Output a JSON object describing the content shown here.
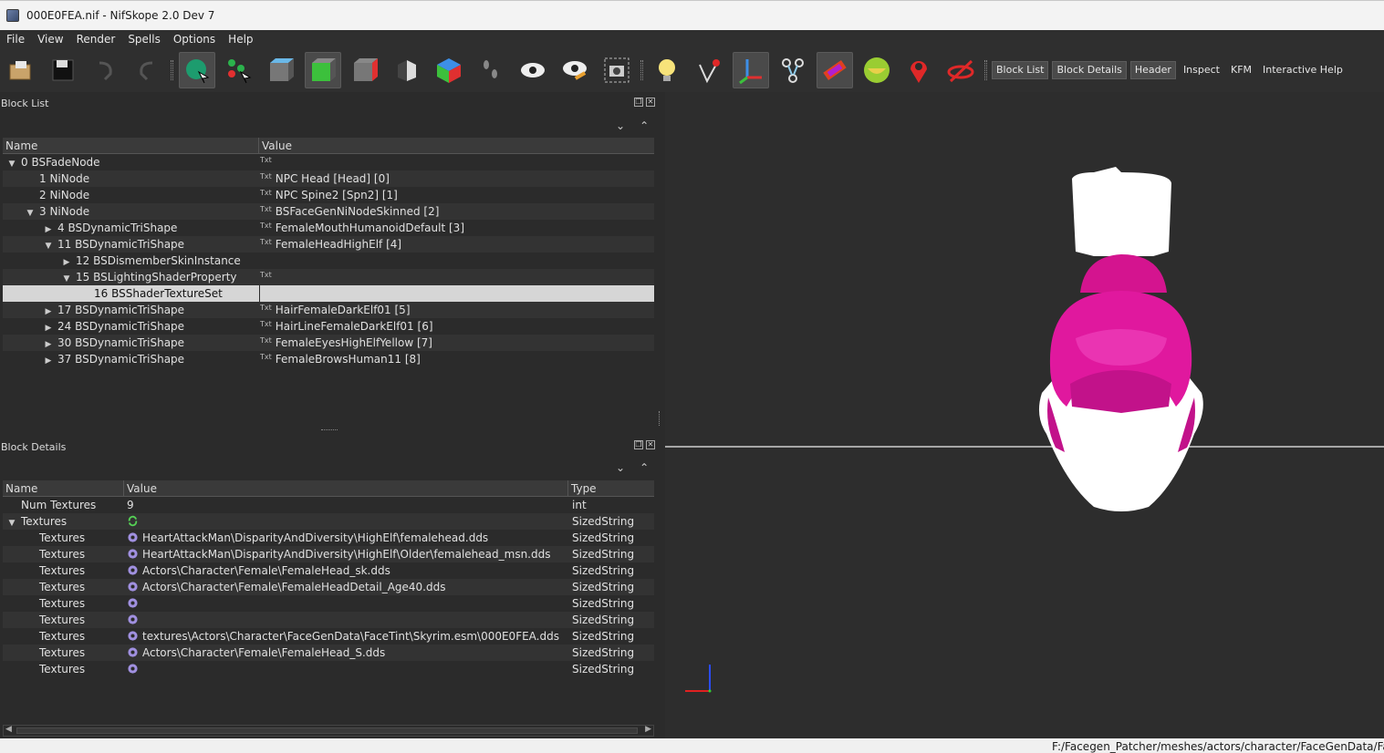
{
  "window": {
    "title": "000E0FEA.nif - NifSkope 2.0 Dev 7"
  },
  "menu": [
    "File",
    "View",
    "Render",
    "Spells",
    "Options",
    "Help"
  ],
  "toolbar": {
    "icons": [
      "load-icon",
      "save-icon",
      "undo-icon",
      "redo-icon",
      "select-icon",
      "select-nodes-icon",
      "view-top-icon",
      "view-front-icon",
      "view-side-icon",
      "view-user-icon",
      "view-axes-icon",
      "walk-icon",
      "show-hidden-icon",
      "show-markers-icon",
      "screenshot-icon",
      "lighting-icon",
      "vertex-icon",
      "axes-icon",
      "nodes-icon",
      "textures-icon",
      "skeleton-icon",
      "marker-icon",
      "constraint-icon"
    ],
    "tabs": [
      "Block List",
      "Block Details",
      "Header",
      "Inspect",
      "KFM",
      "Interactive Help"
    ]
  },
  "block_list": {
    "title": "Block List",
    "columns": [
      "Name",
      "Value"
    ],
    "rows": [
      {
        "name": "0 BSFadeNode",
        "value": "",
        "txt": true,
        "indent": 0,
        "arrow": "down"
      },
      {
        "name": "1 NiNode",
        "value": "NPC Head [Head] [0]",
        "txt": true,
        "indent": 1,
        "arrow": ""
      },
      {
        "name": "2 NiNode",
        "value": "NPC Spine2 [Spn2] [1]",
        "txt": true,
        "indent": 1,
        "arrow": ""
      },
      {
        "name": "3 NiNode",
        "value": "BSFaceGenNiNodeSkinned [2]",
        "txt": true,
        "indent": 1,
        "arrow": "down"
      },
      {
        "name": "4 BSDynamicTriShape",
        "value": "FemaleMouthHumanoidDefault [3]",
        "txt": true,
        "indent": 2,
        "arrow": "right"
      },
      {
        "name": "11 BSDynamicTriShape",
        "value": "FemaleHeadHighElf [4]",
        "txt": true,
        "indent": 2,
        "arrow": "down"
      },
      {
        "name": "12 BSDismemberSkinInstance",
        "value": "",
        "txt": false,
        "indent": 3,
        "arrow": "right"
      },
      {
        "name": "15 BSLightingShaderProperty",
        "value": "",
        "txt": true,
        "indent": 3,
        "arrow": "down"
      },
      {
        "name": "16 BSShaderTextureSet",
        "value": "",
        "txt": false,
        "indent": 4,
        "arrow": "",
        "selected": true
      },
      {
        "name": "17 BSDynamicTriShape",
        "value": "HairFemaleDarkElf01 [5]",
        "txt": true,
        "indent": 2,
        "arrow": "right"
      },
      {
        "name": "24 BSDynamicTriShape",
        "value": "HairLineFemaleDarkElf01 [6]",
        "txt": true,
        "indent": 2,
        "arrow": "right"
      },
      {
        "name": "30 BSDynamicTriShape",
        "value": "FemaleEyesHighElfYellow [7]",
        "txt": true,
        "indent": 2,
        "arrow": "right"
      },
      {
        "name": "37 BSDynamicTriShape",
        "value": "FemaleBrowsHuman11 [8]",
        "txt": true,
        "indent": 2,
        "arrow": "right"
      }
    ]
  },
  "block_details": {
    "title": "Block Details",
    "columns": [
      "Name",
      "Value",
      "Type"
    ],
    "rows": [
      {
        "name": "Num Textures",
        "value": "9",
        "type": "int",
        "indent": 1,
        "arrow": "",
        "icon": ""
      },
      {
        "name": "Textures",
        "value": "",
        "type": "SizedString",
        "indent": 0,
        "arrow": "down",
        "icon": "refresh"
      },
      {
        "name": "Textures",
        "value": "HeartAttackMan\\DisparityAndDiversity\\HighElf\\femalehead.dds",
        "type": "SizedString",
        "indent": 2,
        "arrow": "",
        "icon": "gear"
      },
      {
        "name": "Textures",
        "value": "HeartAttackMan\\DisparityAndDiversity\\HighElf\\Older\\femalehead_msn.dds",
        "type": "SizedString",
        "indent": 2,
        "arrow": "",
        "icon": "gear"
      },
      {
        "name": "Textures",
        "value": "Actors\\Character\\Female\\FemaleHead_sk.dds",
        "type": "SizedString",
        "indent": 2,
        "arrow": "",
        "icon": "gear"
      },
      {
        "name": "Textures",
        "value": "Actors\\Character\\Female\\FemaleHeadDetail_Age40.dds",
        "type": "SizedString",
        "indent": 2,
        "arrow": "",
        "icon": "gear"
      },
      {
        "name": "Textures",
        "value": "",
        "type": "SizedString",
        "indent": 2,
        "arrow": "",
        "icon": "gear"
      },
      {
        "name": "Textures",
        "value": "",
        "type": "SizedString",
        "indent": 2,
        "arrow": "",
        "icon": "gear"
      },
      {
        "name": "Textures",
        "value": "textures\\Actors\\Character\\FaceGenData\\FaceTint\\Skyrim.esm\\000E0FEA.dds",
        "type": "SizedString",
        "indent": 2,
        "arrow": "",
        "icon": "gear"
      },
      {
        "name": "Textures",
        "value": "Actors\\Character\\Female\\FemaleHead_S.dds",
        "type": "SizedString",
        "indent": 2,
        "arrow": "",
        "icon": "gear"
      },
      {
        "name": "Textures",
        "value": "",
        "type": "SizedString",
        "indent": 2,
        "arrow": "",
        "icon": "gear"
      }
    ]
  },
  "status": {
    "path": "F:/Facegen_Patcher/meshes/actors/character/FaceGenData/FaceG"
  },
  "colors": {
    "mesh_accent": "#e0189e",
    "background": "#2b2b2b",
    "selection": "#d6d6d6"
  }
}
